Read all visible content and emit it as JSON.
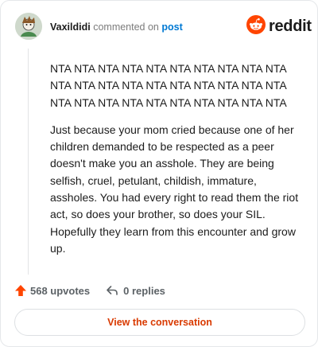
{
  "header": {
    "username": "Vaxildidi",
    "action_text": "commented on",
    "post_link": "post",
    "brand": "reddit"
  },
  "comment": {
    "paragraphs": [
      "NTA NTA NTA NTA NTA NTA NTA NTA NTA NTA NTA NTA NTA NTA NTA NTA NTA NTA NTA NTA NTA NTA NTA NTA NTA NTA NTA NTA NTA NTA",
      "Just because your mom cried because one of her children demanded to be respected as a peer doesn't make you an asshole. They are being selfish, cruel, petulant, childish, immature, assholes. You had every right to read them the riot act, so does your brother, so does your SIL. Hopefully they learn from this encounter and grow up."
    ]
  },
  "footer": {
    "upvotes_label": "568 upvotes",
    "replies_label": "0 replies",
    "cta_label": "View the conversation"
  },
  "colors": {
    "accent": "#ff4500",
    "link": "#0079d3",
    "cta_text": "#d93a00"
  },
  "icons": [
    "avatar",
    "reddit-snoo-icon",
    "upvote-arrow-icon",
    "reply-arrow-icon"
  ]
}
